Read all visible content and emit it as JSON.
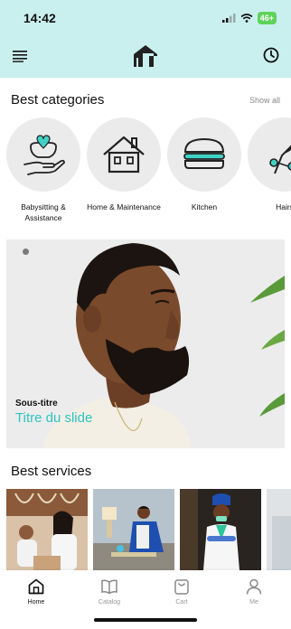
{
  "status_bar": {
    "time": "14:42",
    "battery": "46+"
  },
  "colors": {
    "header_bg": "#c9f0ee",
    "accent": "#2ec4c0",
    "category_bg": "#ebebeb"
  },
  "icons": {
    "menu": "menu-icon",
    "logo": "ht-logo",
    "history": "clock-icon",
    "babysitting": "hand-heart-icon",
    "home": "house-icon",
    "kitchen": "burger-icon",
    "hair": "hair-tool-icon",
    "tab_home": "home-icon",
    "tab_catalog": "book-icon",
    "tab_cart": "bag-icon",
    "tab_me": "user-icon"
  },
  "best_categories": {
    "title": "Best categories",
    "show_all": "Show all",
    "items": [
      {
        "label": "Babysitting & Assistance"
      },
      {
        "label": "Home & Maintenance"
      },
      {
        "label": "Kitchen"
      },
      {
        "label": "Hairs"
      }
    ]
  },
  "slide": {
    "subtitle": "Sous-titre",
    "title": "Titre du slide"
  },
  "best_services": {
    "title": "Best services"
  },
  "tabbar": {
    "items": [
      {
        "label": "Home",
        "active": true
      },
      {
        "label": "Catalog",
        "active": false
      },
      {
        "label": "Cart",
        "active": false
      },
      {
        "label": "Me",
        "active": false
      }
    ]
  }
}
